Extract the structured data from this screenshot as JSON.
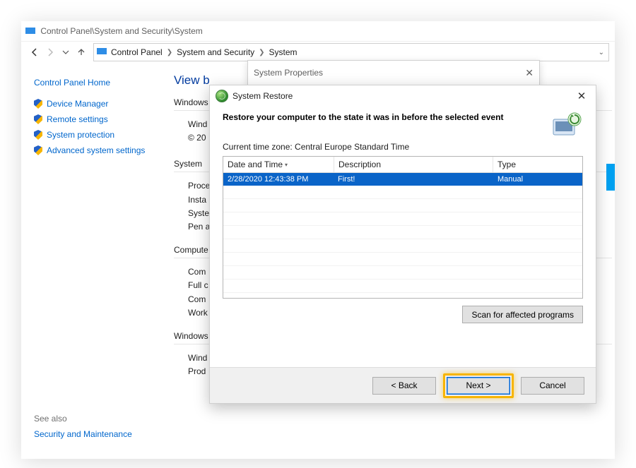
{
  "window_title": "Control Panel\\System and Security\\System",
  "breadcrumb": [
    "Control Panel",
    "System and Security",
    "System"
  ],
  "sidebar": {
    "home": "Control Panel Home",
    "links": [
      "Device Manager",
      "Remote settings",
      "System protection",
      "Advanced system settings"
    ],
    "see_also": "See also",
    "security_maintenance": "Security and Maintenance"
  },
  "content": {
    "heading_prefix": "View b",
    "windows_edition_label": "Windows",
    "wind_partial": "Wind",
    "copyright_partial": "© 20",
    "system_label": "System",
    "system_items": [
      "Proce",
      "Insta",
      "Syste",
      "Pen a"
    ],
    "computer_label": "Compute",
    "computer_items": [
      "Com",
      "Full c",
      "Com",
      "Work"
    ],
    "windows_label2": "Windows",
    "windows_items": [
      "Wind",
      "Prod"
    ]
  },
  "sysprops": {
    "title": "System Properties"
  },
  "restore": {
    "title": "System Restore",
    "heading": "Restore your computer to the state it was in before the selected event",
    "timezone": "Current time zone: Central Europe Standard Time",
    "columns": {
      "datetime": "Date and Time",
      "description": "Description",
      "type": "Type"
    },
    "rows": [
      {
        "datetime": "2/28/2020 12:43:38 PM",
        "description": "First!",
        "type": "Manual"
      }
    ],
    "scan_button": "Scan for affected programs",
    "buttons": {
      "back": "< Back",
      "next": "Next >",
      "cancel": "Cancel"
    }
  }
}
